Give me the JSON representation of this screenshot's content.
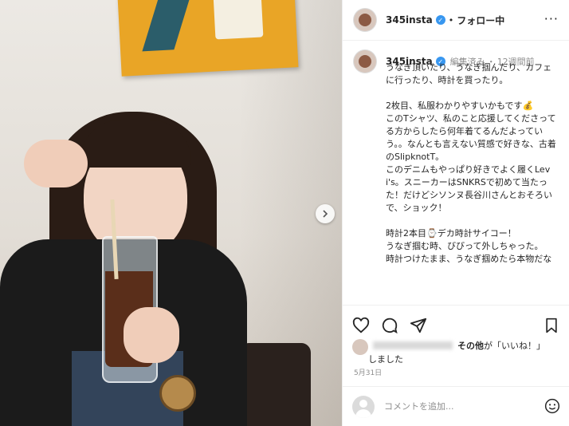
{
  "header": {
    "username": "345insta",
    "separator": "•",
    "follow_label": "フォロー中",
    "more_label": "···"
  },
  "caption": {
    "username": "345insta",
    "edited": "編集済み",
    "separator": "・",
    "time_ago": "12週間前",
    "text": "うなぎ頂いたり、うなぎ掴んだり、カフェに行ったり、時計を買ったり。\n\n2枚目、私服わかりやすいかもです💰\nこのTシャツ、私のこと応援してくださってる方からしたら何年着てるんだよっていう。。なんとも言えない質感で好きな、古着のSlipknotT。\nこのデニムもやっぱり好きでよく履くLevi's。スニーカーはSNKRSで初めて当たった！だけどシソンヌ長谷川さんとおそろいで、ショック！\n\n時計2本目⌚デカ時計サイコー！\nうなぎ掴む時、びびって外しちゃった。\n時計つけたまま、うなぎ掴めたら本物だな"
  },
  "likes": {
    "suffix_bold": "その他",
    "suffix_text": "が「いいね！」しました"
  },
  "date": "5月31日",
  "comment": {
    "placeholder": "コメントを追加..."
  },
  "icons": [
    "chevron-right-icon",
    "verified-badge-icon",
    "heart-icon",
    "comment-icon",
    "share-icon",
    "bookmark-icon",
    "emoji-icon"
  ],
  "colors": {
    "verified": "#3897f0",
    "text": "#262626",
    "muted": "#8e8e8e"
  }
}
